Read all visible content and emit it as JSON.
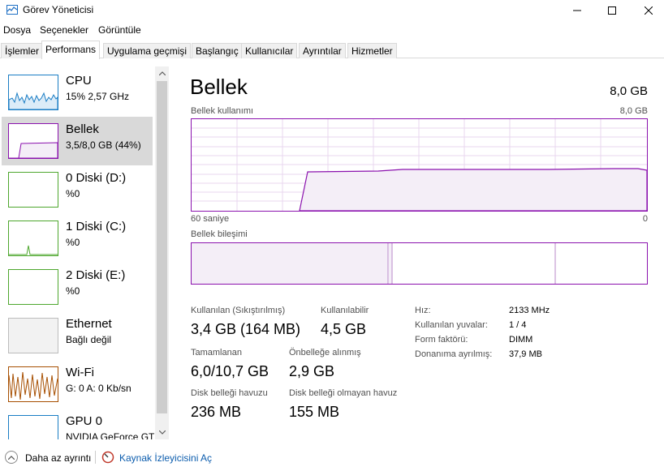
{
  "window": {
    "title": "Görev Yöneticisi"
  },
  "menu": [
    "Dosya",
    "Seçenekler",
    "Görüntüle"
  ],
  "tabs": [
    "İşlemler",
    "Performans",
    "Uygulama geçmişi",
    "Başlangıç",
    "Kullanıcılar",
    "Ayrıntılar",
    "Hizmetler"
  ],
  "active_tab": "Performans",
  "sidebar": {
    "items": [
      {
        "title": "CPU",
        "subtitle": "15%  2,57 GHz",
        "color": "#1a7dc4",
        "selected": false
      },
      {
        "title": "Bellek",
        "subtitle": "3,5/8,0 GB (44%)",
        "color": "#8b12ae",
        "selected": true
      },
      {
        "title": "0 Diski (D:)",
        "subtitle": "%0",
        "color": "#4ea72e",
        "selected": false
      },
      {
        "title": "1 Diski (C:)",
        "subtitle": "%0",
        "color": "#4ea72e",
        "selected": false
      },
      {
        "title": "2 Diski (E:)",
        "subtitle": "%0",
        "color": "#4ea72e",
        "selected": false
      },
      {
        "title": "Ethernet",
        "subtitle": "Bağlı değil",
        "color": "#bcbcbc",
        "selected": false
      },
      {
        "title": "Wi-Fi",
        "subtitle": "G: 0  A: 0 Kb/sn",
        "color": "#a74f01",
        "selected": false
      },
      {
        "title": "GPU 0",
        "subtitle": "NVIDIA GeForce GTX",
        "color": "#1a7dc4",
        "selected": false
      }
    ]
  },
  "main": {
    "title": "Bellek",
    "total": "8,0 GB",
    "usage_label": "Bellek kullanımı",
    "usage_max": "8,0 GB",
    "time_left": "60 saniye",
    "time_right": "0",
    "composition_label": "Bellek bileşimi",
    "stats": {
      "used_label": "Kullanılan (Sıkıştırılmış)",
      "used_value": "3,4 GB (164 MB)",
      "available_label": "Kullanılabilir",
      "available_value": "4,5 GB",
      "committed_label": "Tamamlanan",
      "committed_value": "6,0/10,7 GB",
      "cached_label": "Önbelleğe alınmış",
      "cached_value": "2,9 GB",
      "paged_label": "Disk belleği havuzu",
      "paged_value": "236 MB",
      "nonpaged_label": "Disk belleği olmayan havuz",
      "nonpaged_value": "155 MB"
    },
    "props": [
      {
        "label": "Hız:",
        "value": "2133 MHz"
      },
      {
        "label": "Kullanılan yuvalar:",
        "value": "1 / 4"
      },
      {
        "label": "Form faktörü:",
        "value": "DIMM"
      },
      {
        "label": "Donanıma ayrılmış:",
        "value": "37,9 MB"
      }
    ]
  },
  "footer": {
    "less_details": "Daha az ayrıntı",
    "resource_monitor": "Kaynak İzleyicisini Aç"
  },
  "colors": {
    "memory": "#8b12ae",
    "memory_fill": "#f4eef7",
    "link": "#0b5cad"
  }
}
